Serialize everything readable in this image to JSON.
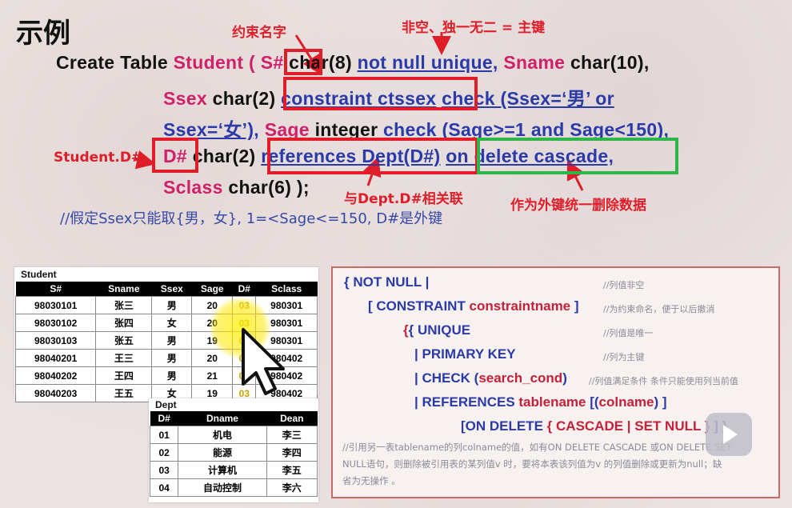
{
  "title": "示例",
  "annotations": {
    "name_constraint": "约束名字",
    "not_null_unique": "非空、独一无二 = 主键",
    "student_d": "Student.D#",
    "relate_dept": "与Dept.D#相关联",
    "cascade_note": "作为外键统一删除数据"
  },
  "code": {
    "l1_create": "Create  Table ",
    "l1_student": "Student",
    "l1_paren": " ( ",
    "l1_s": "S#",
    "l1_type": " char(8) ",
    "l1_nn": "not null  unique,",
    "l1_sname": "Sname",
    "l1_type2": "  char(10),",
    "l2_ssex": "Ssex",
    "l2_type": "  char(2)  ",
    "l2_constraint": "constraint  ctssex",
    "l2_check": "check  (Ssex=‘男’   or",
    "l3_ssex": "Ssex=‘女’),",
    "l3_sage": "Sage",
    "l3_int": "  integer  ",
    "l3_check": "check (Sage>=1  and Sage<150),",
    "l4_d": "D#",
    "l4_type": "  char(2)  ",
    "l4_ref": "references  Dept(D#)",
    "l4_on": "on delete cascade,",
    "l5_sclass": "Sclass",
    "l5_type": "  char(6) );"
  },
  "comment": "//假定Ssex只能取{男，女}, 1=<Sage<=150, D#是外键",
  "student_table": {
    "caption": "Student",
    "headers": [
      "S#",
      "Sname",
      "Ssex",
      "Sage",
      "D#",
      "Sclass"
    ],
    "rows": [
      [
        "98030101",
        "张三",
        "男",
        "20",
        "03",
        "980301"
      ],
      [
        "98030102",
        "张四",
        "女",
        "20",
        "03",
        "980301"
      ],
      [
        "98030103",
        "张五",
        "男",
        "19",
        "03",
        "980301"
      ],
      [
        "98040201",
        "王三",
        "男",
        "20",
        "03",
        "980402"
      ],
      [
        "98040202",
        "王四",
        "男",
        "21",
        "03",
        "980402"
      ],
      [
        "98040203",
        "王五",
        "女",
        "19",
        "03",
        "980402"
      ]
    ]
  },
  "dept_table": {
    "caption": "Dept",
    "headers": [
      "D#",
      "Dname",
      "Dean"
    ],
    "rows": [
      [
        "01",
        "机电",
        "李三"
      ],
      [
        "02",
        "能源",
        "李四"
      ],
      [
        "03",
        "计算机",
        "李五"
      ],
      [
        "04",
        "自动控制",
        "李六"
      ]
    ]
  },
  "grammar": {
    "g1": "{ NOT NULL |",
    "g2a": "[ CONSTRAINT ",
    "g2b": "constraintname",
    "g2c": " ]",
    "g3": "{ UNIQUE",
    "g4": "| PRIMARY KEY",
    "g5a": "| CHECK  (",
    "g5b": "search_cond",
    "g5c": ")",
    "g6a": "| REFERENCES   ",
    "g6b": "tablename",
    "g6c": "   [(",
    "g6d": "colname",
    "g6e": ")  ]",
    "g7a": "[ON DELETE ",
    "g7b": "{ CASCADE | SET NULL }",
    "g7c": " ] }",
    "n1": "//列值非空",
    "n2": "//为约束命名，便于以后撤消",
    "n3": "//列值是唯一",
    "n4": "//列为主键",
    "n5": "//列值满足条件 条件只能使用列当前值",
    "p1": "//引用另一表tablename的列colname的值，如有ON DELETE CASCADE 或ON DELETE SET",
    "p2": "NULL语句，则删除被引用表的某列值v 时，要将本表该列值为v 的列值删除或更新为null；缺",
    "p3": "省为无操作 。"
  },
  "colors": {
    "red_box": "#e01e2a",
    "green_box": "#2fb64a",
    "keyword": "#d0206a",
    "link_blue": "#2a3aa8"
  }
}
